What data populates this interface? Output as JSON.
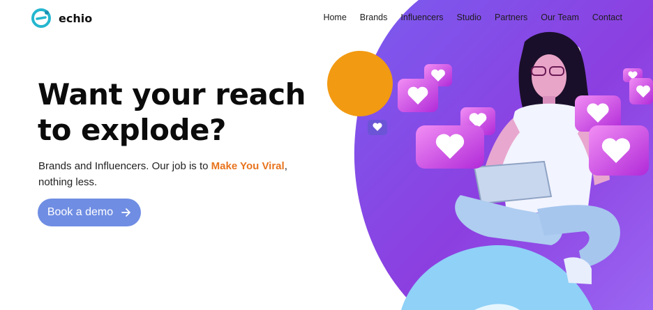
{
  "brand": {
    "name": "echio",
    "logo_icon": "echio-logo-icon"
  },
  "nav": {
    "items": [
      {
        "label": "Home"
      },
      {
        "label": "Brands"
      },
      {
        "label": "Influencers"
      },
      {
        "label": "Studio"
      },
      {
        "label": "Partners"
      },
      {
        "label": "Our Team"
      },
      {
        "label": "Contact"
      }
    ]
  },
  "hero": {
    "headline_line1": "Want your reach",
    "headline_line2": "to explode?",
    "sub_before": "Brands and Influencers. Our job is to ",
    "sub_accent": "Make You Viral",
    "sub_after": ",",
    "sub_line2": "nothing less.",
    "cta_label": "Book a demo",
    "cta_icon": "arrow-right-icon"
  },
  "colors": {
    "accent_orange": "#e8741e",
    "cta_blue": "#6f8de3",
    "orange_circle": "#f29a12",
    "purple_blob": "#8a4fe6",
    "light_blue_blob": "#8fd1f7"
  }
}
